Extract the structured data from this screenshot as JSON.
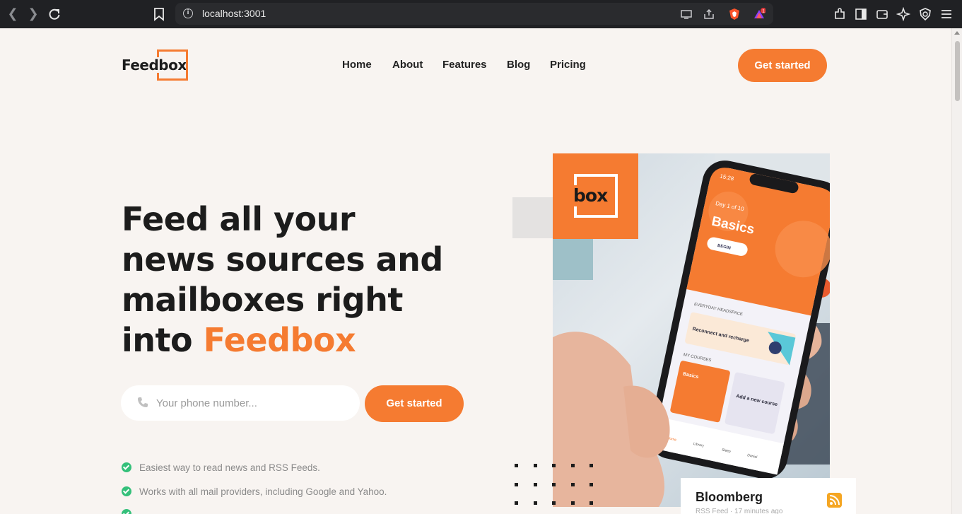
{
  "browser": {
    "url": "localhost:3001",
    "brave_badge_count": "1"
  },
  "header": {
    "logo_text": "Feedbox",
    "nav": [
      "Home",
      "About",
      "Features",
      "Blog",
      "Pricing"
    ],
    "cta_label": "Get started"
  },
  "hero": {
    "title_line1": "Feed all your",
    "title_line2": "news sources and",
    "title_line3": "mailboxes right",
    "title_line4_prefix": "into ",
    "title_accent": "Feedbox",
    "phone_placeholder": "Your phone number...",
    "cta_label": "Get started",
    "features": [
      "Easiest way to read news and RSS Feeds.",
      "Works with all mail providers, including Google and Yahoo."
    ]
  },
  "visual": {
    "box_logo_text": "box",
    "app_screen": {
      "time": "15:28",
      "day_label": "Day 1 of 10",
      "course_title": "Basics",
      "begin_label": "BEGIN",
      "section_headspace": "EVERYDAY HEADSPACE",
      "headspace_item": "Reconnect and recharge",
      "section_courses": "MY COURSES",
      "course_card": "Basics",
      "add_course": "Add a new course",
      "tabs": [
        "Home",
        "Library",
        "Sleep",
        "Daniel"
      ]
    },
    "feed_card": {
      "title": "Bloomberg",
      "subtitle": "RSS Feed · 17 minutes ago"
    }
  },
  "colors": {
    "accent": "#f57b31",
    "background": "#f8f4f1",
    "check": "#34c07a"
  }
}
